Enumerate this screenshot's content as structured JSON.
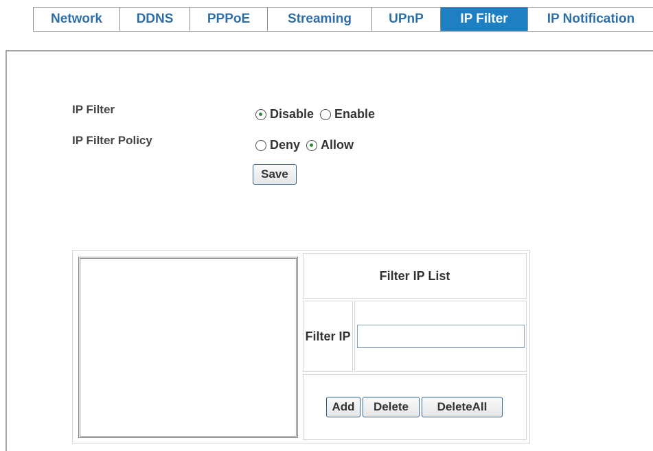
{
  "tabs": [
    {
      "label": "Network"
    },
    {
      "label": "DDNS"
    },
    {
      "label": "PPPoE"
    },
    {
      "label": "Streaming"
    },
    {
      "label": "UPnP"
    },
    {
      "label": "IP Filter",
      "active": true
    },
    {
      "label": "IP Notification"
    }
  ],
  "settings": {
    "ip_filter_label": "IP Filter",
    "ip_filter_options": [
      {
        "label": "Disable",
        "checked": true
      },
      {
        "label": "Enable",
        "checked": false
      }
    ],
    "policy_label": "IP Filter Policy",
    "policy_options": [
      {
        "label": "Deny",
        "checked": false
      },
      {
        "label": "Allow",
        "checked": true
      }
    ],
    "save_label": "Save"
  },
  "filter_list": {
    "title": "Filter IP List",
    "filter_ip_label": "Filter IP",
    "filter_ip_value": "",
    "add_label": "Add",
    "delete_label": "Delete",
    "delete_all_label": "DeleteAll",
    "entries": []
  },
  "colors": {
    "active_tab_bg": "#1e7fc2",
    "tab_text": "#2d6ea8",
    "radio_dot": "#2f8a3a"
  }
}
